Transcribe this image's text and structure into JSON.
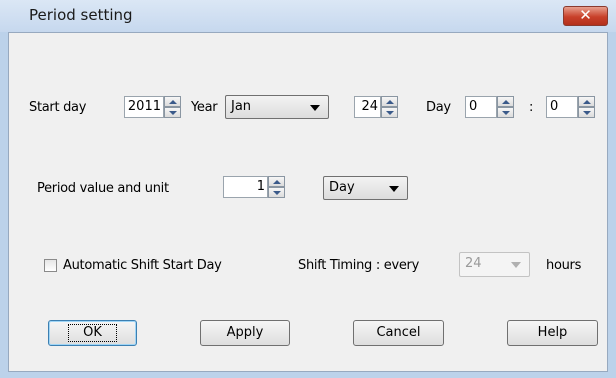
{
  "window": {
    "title": "Period setting",
    "close_label": "✕"
  },
  "start_day": {
    "label": "Start day",
    "year_value": "2011",
    "year_label": "Year",
    "month_selected": "Jan",
    "day_value": "24",
    "day_label": "Day",
    "hour_value": "0",
    "time_separator": ":",
    "minute_value": "0"
  },
  "period": {
    "label": "Period value and unit",
    "value": "1",
    "unit_selected": "Day"
  },
  "shift": {
    "checkbox_label": "Automatic Shift Start Day",
    "checked": false,
    "timing_label": "Shift Timing : every",
    "hours_selected": "24",
    "hours_disabled": true,
    "hours_unit": "hours"
  },
  "buttons": {
    "ok": "OK",
    "apply": "Apply",
    "cancel": "Cancel",
    "help": "Help"
  },
  "colors": {
    "frame": "#bcd2ea",
    "client": "#f0f0f0",
    "close_button": "#c8402a"
  }
}
